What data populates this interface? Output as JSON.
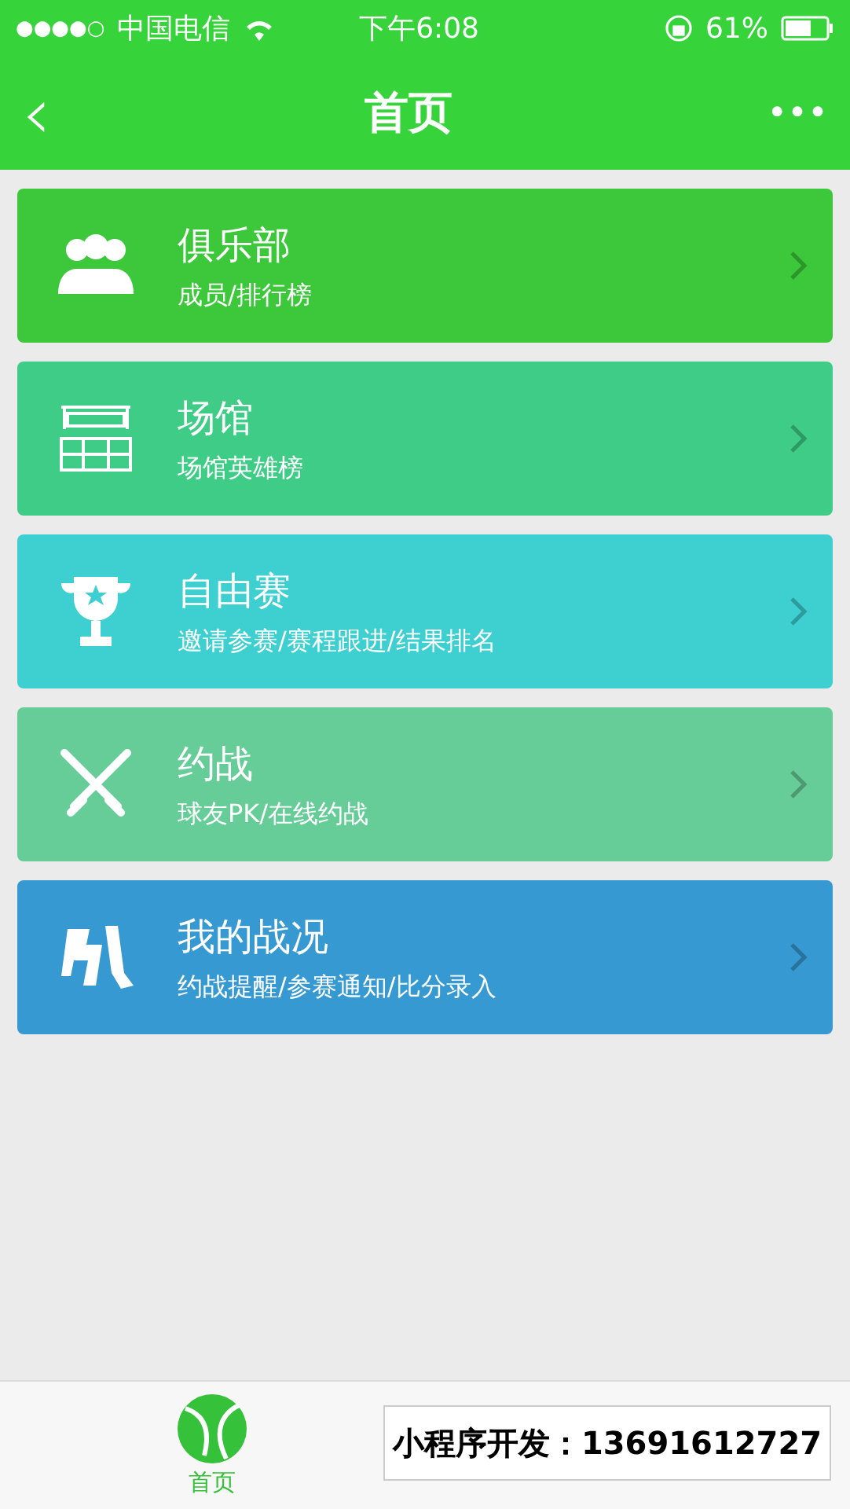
{
  "status_bar": {
    "signal_dots": "●●●●○",
    "carrier": "中国电信",
    "time": "下午6:08",
    "battery": "61%"
  },
  "nav": {
    "back": "‹",
    "title": "首页",
    "more": "•••"
  },
  "cards": [
    {
      "kind": "club",
      "title": "俱乐部",
      "subtitle": "成员/排行榜",
      "color": "#3cc83a"
    },
    {
      "kind": "court",
      "title": "场馆",
      "subtitle": "场馆英雄榜",
      "color": "#3fcc86"
    },
    {
      "kind": "trophy",
      "title": "自由赛",
      "subtitle": "邀请参赛/赛程跟进/结果排名",
      "color": "#3ecfd0"
    },
    {
      "kind": "swords",
      "title": "约战",
      "subtitle": "球友PK/在线约战",
      "color": "#66cc98"
    },
    {
      "kind": "battle",
      "title": "我的战况",
      "subtitle": "约战提醒/参赛通知/比分录入",
      "color": "#3699d1"
    }
  ],
  "tab_bar": [
    {
      "label": "首页",
      "selected": true
    }
  ],
  "promo_banner": "小程序开发：13691612727"
}
